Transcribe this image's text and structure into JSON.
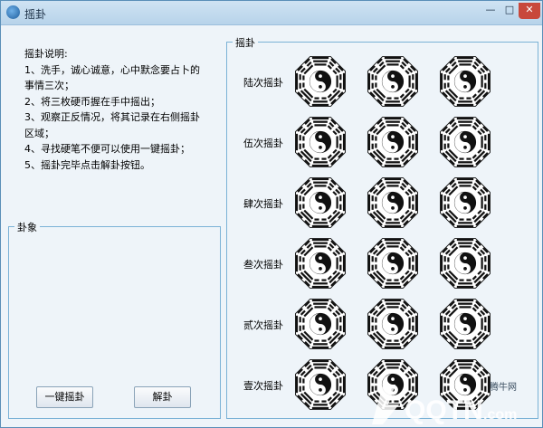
{
  "window": {
    "title": "摇卦",
    "min": "—",
    "max": "□",
    "close": "✕"
  },
  "instructions": {
    "heading": "摇卦说明:",
    "lines": [
      "1、洗手，诚心诚意，心中默念要占卜的",
      "事情三次；",
      "2、将三枚硬币握在手中摇出；",
      "3、观察正反情况，将其记录在右侧摇卦",
      "区域；",
      "4、寻找硬笔不便可以使用一键摇卦；",
      "5、摇卦完毕点击解卦按钮。"
    ]
  },
  "guaxiang": {
    "label": "卦象"
  },
  "buttons": {
    "one_key": "一键摇卦",
    "interpret": "解卦"
  },
  "yaogua": {
    "label": "摇卦",
    "rows": [
      "陆次摇卦",
      "伍次摇卦",
      "肆次摇卦",
      "叁次摇卦",
      "贰次摇卦",
      "壹次摇卦"
    ]
  },
  "watermark": {
    "brand": "QQTN",
    "suffix": ".com",
    "cn": "腾牛网"
  },
  "icons": {
    "app": "taiji-app-icon",
    "coin": "bagua-taiji-coin"
  }
}
